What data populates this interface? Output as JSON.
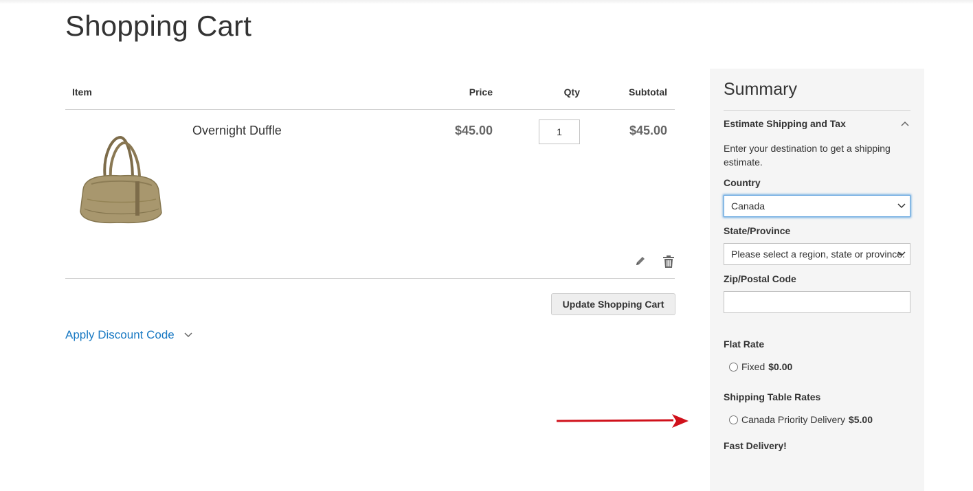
{
  "page": {
    "title": "Shopping Cart"
  },
  "cart": {
    "headers": {
      "item": "Item",
      "price": "Price",
      "qty": "Qty",
      "subtotal": "Subtotal"
    },
    "items": [
      {
        "name": "Overnight Duffle",
        "price": "$45.00",
        "qty": "1",
        "subtotal": "$45.00",
        "image": "duffle-bag"
      }
    ],
    "update_label": "Update Shopping Cart",
    "discount_label": "Apply Discount Code"
  },
  "summary": {
    "title": "Summary",
    "estimate_title": "Estimate Shipping and Tax",
    "estimate_note": "Enter your destination to get a shipping estimate.",
    "country_label": "Country",
    "country_value": "Canada",
    "state_label": "State/Province",
    "state_value": "Please select a region, state or province.",
    "zip_label": "Zip/Postal Code",
    "zip_value": "",
    "flat_rate": {
      "title": "Flat Rate",
      "option": "Fixed",
      "amount": "$0.00"
    },
    "table_rates": {
      "title": "Shipping Table Rates",
      "option": "Canada Priority Delivery",
      "amount": "$5.00"
    },
    "fast_delivery": "Fast Delivery!"
  },
  "colors": {
    "link": "#1979c3",
    "arrow": "#d0111b",
    "summary_bg": "#f5f5f5",
    "focus": "#68a8e0"
  }
}
